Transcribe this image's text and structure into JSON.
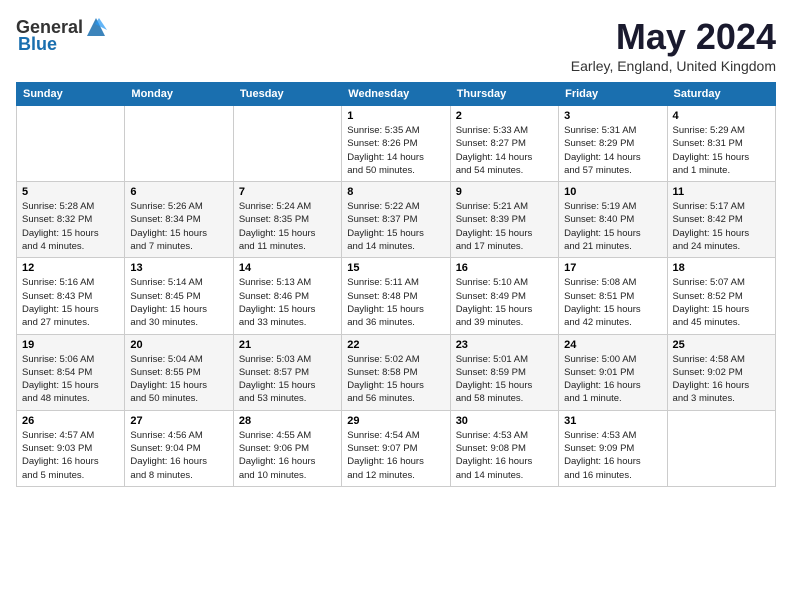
{
  "header": {
    "logo_general": "General",
    "logo_blue": "Blue",
    "month_year": "May 2024",
    "location": "Earley, England, United Kingdom"
  },
  "days_of_week": [
    "Sunday",
    "Monday",
    "Tuesday",
    "Wednesday",
    "Thursday",
    "Friday",
    "Saturday"
  ],
  "weeks": [
    [
      {
        "day": "",
        "info": ""
      },
      {
        "day": "",
        "info": ""
      },
      {
        "day": "",
        "info": ""
      },
      {
        "day": "1",
        "info": "Sunrise: 5:35 AM\nSunset: 8:26 PM\nDaylight: 14 hours\nand 50 minutes."
      },
      {
        "day": "2",
        "info": "Sunrise: 5:33 AM\nSunset: 8:27 PM\nDaylight: 14 hours\nand 54 minutes."
      },
      {
        "day": "3",
        "info": "Sunrise: 5:31 AM\nSunset: 8:29 PM\nDaylight: 14 hours\nand 57 minutes."
      },
      {
        "day": "4",
        "info": "Sunrise: 5:29 AM\nSunset: 8:31 PM\nDaylight: 15 hours\nand 1 minute."
      }
    ],
    [
      {
        "day": "5",
        "info": "Sunrise: 5:28 AM\nSunset: 8:32 PM\nDaylight: 15 hours\nand 4 minutes."
      },
      {
        "day": "6",
        "info": "Sunrise: 5:26 AM\nSunset: 8:34 PM\nDaylight: 15 hours\nand 7 minutes."
      },
      {
        "day": "7",
        "info": "Sunrise: 5:24 AM\nSunset: 8:35 PM\nDaylight: 15 hours\nand 11 minutes."
      },
      {
        "day": "8",
        "info": "Sunrise: 5:22 AM\nSunset: 8:37 PM\nDaylight: 15 hours\nand 14 minutes."
      },
      {
        "day": "9",
        "info": "Sunrise: 5:21 AM\nSunset: 8:39 PM\nDaylight: 15 hours\nand 17 minutes."
      },
      {
        "day": "10",
        "info": "Sunrise: 5:19 AM\nSunset: 8:40 PM\nDaylight: 15 hours\nand 21 minutes."
      },
      {
        "day": "11",
        "info": "Sunrise: 5:17 AM\nSunset: 8:42 PM\nDaylight: 15 hours\nand 24 minutes."
      }
    ],
    [
      {
        "day": "12",
        "info": "Sunrise: 5:16 AM\nSunset: 8:43 PM\nDaylight: 15 hours\nand 27 minutes."
      },
      {
        "day": "13",
        "info": "Sunrise: 5:14 AM\nSunset: 8:45 PM\nDaylight: 15 hours\nand 30 minutes."
      },
      {
        "day": "14",
        "info": "Sunrise: 5:13 AM\nSunset: 8:46 PM\nDaylight: 15 hours\nand 33 minutes."
      },
      {
        "day": "15",
        "info": "Sunrise: 5:11 AM\nSunset: 8:48 PM\nDaylight: 15 hours\nand 36 minutes."
      },
      {
        "day": "16",
        "info": "Sunrise: 5:10 AM\nSunset: 8:49 PM\nDaylight: 15 hours\nand 39 minutes."
      },
      {
        "day": "17",
        "info": "Sunrise: 5:08 AM\nSunset: 8:51 PM\nDaylight: 15 hours\nand 42 minutes."
      },
      {
        "day": "18",
        "info": "Sunrise: 5:07 AM\nSunset: 8:52 PM\nDaylight: 15 hours\nand 45 minutes."
      }
    ],
    [
      {
        "day": "19",
        "info": "Sunrise: 5:06 AM\nSunset: 8:54 PM\nDaylight: 15 hours\nand 48 minutes."
      },
      {
        "day": "20",
        "info": "Sunrise: 5:04 AM\nSunset: 8:55 PM\nDaylight: 15 hours\nand 50 minutes."
      },
      {
        "day": "21",
        "info": "Sunrise: 5:03 AM\nSunset: 8:57 PM\nDaylight: 15 hours\nand 53 minutes."
      },
      {
        "day": "22",
        "info": "Sunrise: 5:02 AM\nSunset: 8:58 PM\nDaylight: 15 hours\nand 56 minutes."
      },
      {
        "day": "23",
        "info": "Sunrise: 5:01 AM\nSunset: 8:59 PM\nDaylight: 15 hours\nand 58 minutes."
      },
      {
        "day": "24",
        "info": "Sunrise: 5:00 AM\nSunset: 9:01 PM\nDaylight: 16 hours\nand 1 minute."
      },
      {
        "day": "25",
        "info": "Sunrise: 4:58 AM\nSunset: 9:02 PM\nDaylight: 16 hours\nand 3 minutes."
      }
    ],
    [
      {
        "day": "26",
        "info": "Sunrise: 4:57 AM\nSunset: 9:03 PM\nDaylight: 16 hours\nand 5 minutes."
      },
      {
        "day": "27",
        "info": "Sunrise: 4:56 AM\nSunset: 9:04 PM\nDaylight: 16 hours\nand 8 minutes."
      },
      {
        "day": "28",
        "info": "Sunrise: 4:55 AM\nSunset: 9:06 PM\nDaylight: 16 hours\nand 10 minutes."
      },
      {
        "day": "29",
        "info": "Sunrise: 4:54 AM\nSunset: 9:07 PM\nDaylight: 16 hours\nand 12 minutes."
      },
      {
        "day": "30",
        "info": "Sunrise: 4:53 AM\nSunset: 9:08 PM\nDaylight: 16 hours\nand 14 minutes."
      },
      {
        "day": "31",
        "info": "Sunrise: 4:53 AM\nSunset: 9:09 PM\nDaylight: 16 hours\nand 16 minutes."
      },
      {
        "day": "",
        "info": ""
      }
    ]
  ]
}
